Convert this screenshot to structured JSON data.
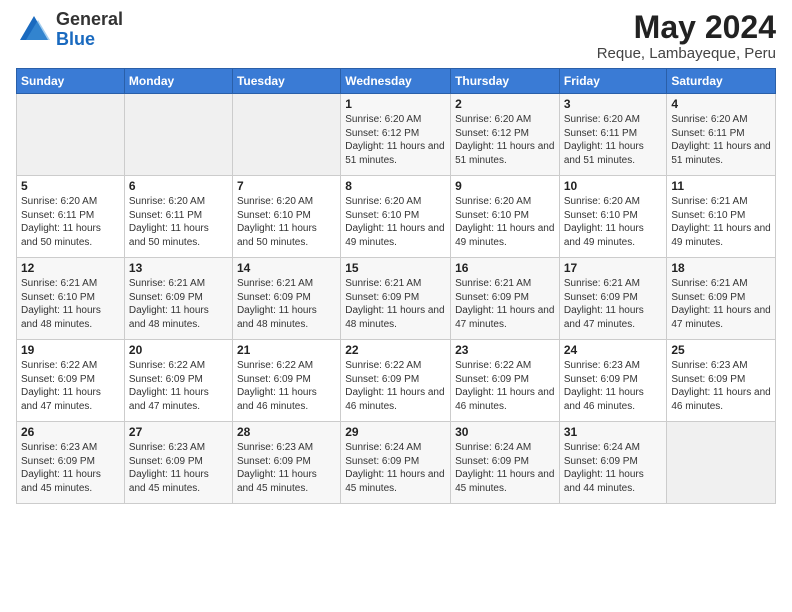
{
  "logo": {
    "general": "General",
    "blue": "Blue"
  },
  "title": "May 2024",
  "subtitle": "Reque, Lambayeque, Peru",
  "weekdays": [
    "Sunday",
    "Monday",
    "Tuesday",
    "Wednesday",
    "Thursday",
    "Friday",
    "Saturday"
  ],
  "weeks": [
    [
      {
        "day": "",
        "info": ""
      },
      {
        "day": "",
        "info": ""
      },
      {
        "day": "",
        "info": ""
      },
      {
        "day": "1",
        "info": "Sunrise: 6:20 AM\nSunset: 6:12 PM\nDaylight: 11 hours and 51 minutes."
      },
      {
        "day": "2",
        "info": "Sunrise: 6:20 AM\nSunset: 6:12 PM\nDaylight: 11 hours and 51 minutes."
      },
      {
        "day": "3",
        "info": "Sunrise: 6:20 AM\nSunset: 6:11 PM\nDaylight: 11 hours and 51 minutes."
      },
      {
        "day": "4",
        "info": "Sunrise: 6:20 AM\nSunset: 6:11 PM\nDaylight: 11 hours and 51 minutes."
      }
    ],
    [
      {
        "day": "5",
        "info": "Sunrise: 6:20 AM\nSunset: 6:11 PM\nDaylight: 11 hours and 50 minutes."
      },
      {
        "day": "6",
        "info": "Sunrise: 6:20 AM\nSunset: 6:11 PM\nDaylight: 11 hours and 50 minutes."
      },
      {
        "day": "7",
        "info": "Sunrise: 6:20 AM\nSunset: 6:10 PM\nDaylight: 11 hours and 50 minutes."
      },
      {
        "day": "8",
        "info": "Sunrise: 6:20 AM\nSunset: 6:10 PM\nDaylight: 11 hours and 49 minutes."
      },
      {
        "day": "9",
        "info": "Sunrise: 6:20 AM\nSunset: 6:10 PM\nDaylight: 11 hours and 49 minutes."
      },
      {
        "day": "10",
        "info": "Sunrise: 6:20 AM\nSunset: 6:10 PM\nDaylight: 11 hours and 49 minutes."
      },
      {
        "day": "11",
        "info": "Sunrise: 6:21 AM\nSunset: 6:10 PM\nDaylight: 11 hours and 49 minutes."
      }
    ],
    [
      {
        "day": "12",
        "info": "Sunrise: 6:21 AM\nSunset: 6:10 PM\nDaylight: 11 hours and 48 minutes."
      },
      {
        "day": "13",
        "info": "Sunrise: 6:21 AM\nSunset: 6:09 PM\nDaylight: 11 hours and 48 minutes."
      },
      {
        "day": "14",
        "info": "Sunrise: 6:21 AM\nSunset: 6:09 PM\nDaylight: 11 hours and 48 minutes."
      },
      {
        "day": "15",
        "info": "Sunrise: 6:21 AM\nSunset: 6:09 PM\nDaylight: 11 hours and 48 minutes."
      },
      {
        "day": "16",
        "info": "Sunrise: 6:21 AM\nSunset: 6:09 PM\nDaylight: 11 hours and 47 minutes."
      },
      {
        "day": "17",
        "info": "Sunrise: 6:21 AM\nSunset: 6:09 PM\nDaylight: 11 hours and 47 minutes."
      },
      {
        "day": "18",
        "info": "Sunrise: 6:21 AM\nSunset: 6:09 PM\nDaylight: 11 hours and 47 minutes."
      }
    ],
    [
      {
        "day": "19",
        "info": "Sunrise: 6:22 AM\nSunset: 6:09 PM\nDaylight: 11 hours and 47 minutes."
      },
      {
        "day": "20",
        "info": "Sunrise: 6:22 AM\nSunset: 6:09 PM\nDaylight: 11 hours and 47 minutes."
      },
      {
        "day": "21",
        "info": "Sunrise: 6:22 AM\nSunset: 6:09 PM\nDaylight: 11 hours and 46 minutes."
      },
      {
        "day": "22",
        "info": "Sunrise: 6:22 AM\nSunset: 6:09 PM\nDaylight: 11 hours and 46 minutes."
      },
      {
        "day": "23",
        "info": "Sunrise: 6:22 AM\nSunset: 6:09 PM\nDaylight: 11 hours and 46 minutes."
      },
      {
        "day": "24",
        "info": "Sunrise: 6:23 AM\nSunset: 6:09 PM\nDaylight: 11 hours and 46 minutes."
      },
      {
        "day": "25",
        "info": "Sunrise: 6:23 AM\nSunset: 6:09 PM\nDaylight: 11 hours and 46 minutes."
      }
    ],
    [
      {
        "day": "26",
        "info": "Sunrise: 6:23 AM\nSunset: 6:09 PM\nDaylight: 11 hours and 45 minutes."
      },
      {
        "day": "27",
        "info": "Sunrise: 6:23 AM\nSunset: 6:09 PM\nDaylight: 11 hours and 45 minutes."
      },
      {
        "day": "28",
        "info": "Sunrise: 6:23 AM\nSunset: 6:09 PM\nDaylight: 11 hours and 45 minutes."
      },
      {
        "day": "29",
        "info": "Sunrise: 6:24 AM\nSunset: 6:09 PM\nDaylight: 11 hours and 45 minutes."
      },
      {
        "day": "30",
        "info": "Sunrise: 6:24 AM\nSunset: 6:09 PM\nDaylight: 11 hours and 45 minutes."
      },
      {
        "day": "31",
        "info": "Sunrise: 6:24 AM\nSunset: 6:09 PM\nDaylight: 11 hours and 44 minutes."
      },
      {
        "day": "",
        "info": ""
      }
    ]
  ]
}
